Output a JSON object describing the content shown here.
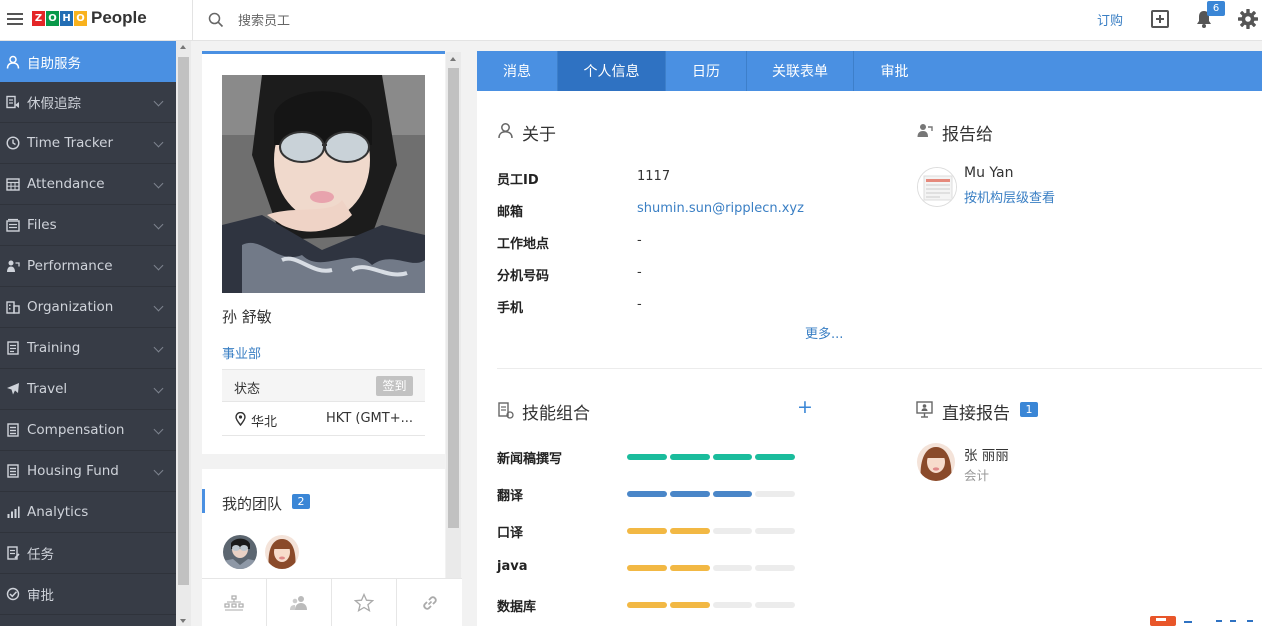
{
  "header": {
    "logo_letters": [
      "Z",
      "O",
      "H",
      "O"
    ],
    "logo_colors": [
      "#e42527",
      "#089949",
      "#226db4",
      "#f9b21d"
    ],
    "app_name": "People",
    "search_placeholder": "搜索员工",
    "subscribe_label": "订购",
    "notification_count": "6",
    "icons": [
      "menu-icon",
      "search-icon",
      "plus-box-icon",
      "bell-icon",
      "gear-icon"
    ]
  },
  "sidebar": {
    "items": [
      {
        "label": "自助服务",
        "icon": "user-icon",
        "active": true
      },
      {
        "label": "休假追踪",
        "icon": "leave-icon"
      },
      {
        "label": "Time Tracker",
        "icon": "clock-icon"
      },
      {
        "label": "Attendance",
        "icon": "calendar-grid-icon"
      },
      {
        "label": "Files",
        "icon": "files-icon"
      },
      {
        "label": "Performance",
        "icon": "performance-icon"
      },
      {
        "label": "Organization",
        "icon": "organization-icon"
      },
      {
        "label": "Training",
        "icon": "training-icon"
      },
      {
        "label": "Travel",
        "icon": "plane-icon"
      },
      {
        "label": "Compensation",
        "icon": "compensation-icon"
      },
      {
        "label": "Housing Fund",
        "icon": "housing-icon"
      },
      {
        "label": "Analytics",
        "icon": "analytics-icon"
      },
      {
        "label": "任务",
        "icon": "task-icon"
      },
      {
        "label": "审批",
        "icon": "approval-icon"
      }
    ]
  },
  "profile": {
    "name": "孙 舒敏",
    "department": "事业部",
    "status_label": "状态",
    "checkin_label": "签到",
    "location": "华北",
    "timezone": "HKT (GMT+..."
  },
  "team": {
    "title": "我的团队",
    "count": "2"
  },
  "tabs": [
    {
      "label": "消息"
    },
    {
      "label": "个人信息",
      "active": true
    },
    {
      "label": "日历"
    },
    {
      "label": "关联表单"
    },
    {
      "label": "审批"
    }
  ],
  "about": {
    "title": "关于",
    "fields": [
      {
        "label": "员工ID",
        "value": "1117"
      },
      {
        "label": "邮箱",
        "value": "shumin.sun@ripplecn.xyz",
        "link": true
      },
      {
        "label": "工作地点",
        "value": "-"
      },
      {
        "label": "分机号码",
        "value": "-"
      },
      {
        "label": "手机",
        "value": "-"
      }
    ],
    "more_label": "更多..."
  },
  "reports_to": {
    "title": "报告给",
    "name": "Mu Yan",
    "link_label": "按机构层级查看"
  },
  "skills": {
    "title": "技能组合",
    "add_label": "+",
    "items": [
      {
        "label": "新闻稿撰写",
        "level": 4,
        "max": 4,
        "color": "#1abc9c"
      },
      {
        "label": "翻译",
        "level": 3,
        "max": 4,
        "color": "#4a86c8"
      },
      {
        "label": "口译",
        "level": 2,
        "max": 4,
        "color": "#f2b844"
      },
      {
        "label": "java",
        "level": 2,
        "max": 4,
        "color": "#f2b844"
      },
      {
        "label": "数据库",
        "level": 2,
        "max": 4,
        "color": "#f2b844"
      }
    ]
  },
  "direct_reports": {
    "title": "直接报告",
    "count": "1",
    "items": [
      {
        "name": "张 丽丽",
        "role": "会计"
      }
    ]
  }
}
